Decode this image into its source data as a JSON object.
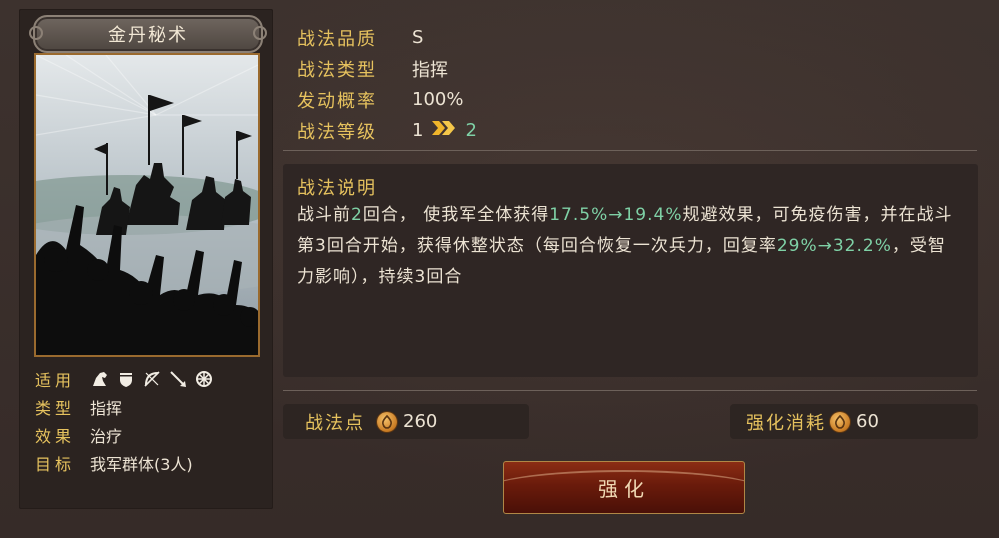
{
  "skill": {
    "name": "金丹秘术",
    "properties": [
      {
        "label": "适用",
        "value": "",
        "icons": [
          "cavalry-icon",
          "shield-icon",
          "bow-icon",
          "spear-icon",
          "wheel-icon"
        ]
      },
      {
        "label": "类型",
        "value": "指挥"
      },
      {
        "label": "效果",
        "value": "治疗"
      },
      {
        "label": "目标",
        "value": "我军群体(3人)"
      }
    ]
  },
  "stats": {
    "quality_label": "战法品质",
    "quality_value": "S",
    "type_label": "战法类型",
    "type_value": "指挥",
    "rate_label": "发动概率",
    "rate_value": "100%",
    "level_label": "战法等级",
    "level_current": "1",
    "level_next": "2",
    "level_arrow_icon": "double-chevron-right-icon"
  },
  "description": {
    "title": "战法说明",
    "segments": [
      {
        "text": "战斗前",
        "hl": false
      },
      {
        "text": "2",
        "hl": true
      },
      {
        "text": "回合， 使我军全体获得",
        "hl": false
      },
      {
        "text": "17.5%→19.4%",
        "hl": true
      },
      {
        "text": "规避效果，可免疫伤害，并在战斗第",
        "hl": false
      },
      {
        "text": "3",
        "hl": false
      },
      {
        "text": "回合开始，获得休整状态（每回合恢复一次兵力，回复率",
        "hl": false
      },
      {
        "text": "29%→32.2%",
        "hl": true
      },
      {
        "text": "，受智力影响），持续",
        "hl": false
      },
      {
        "text": "3",
        "hl": false
      },
      {
        "text": "回合",
        "hl": false
      }
    ]
  },
  "points": {
    "label": "战法点",
    "value": "260",
    "icon": "copper-coin-icon"
  },
  "cost": {
    "label": "强化消耗",
    "value": "60",
    "icon": "copper-coin-icon"
  },
  "upgrade_button": {
    "label": "强化"
  },
  "colors": {
    "gold_label": "#e6c25e",
    "highlight_green": "#7fd1a6",
    "button_red": "#6a1b0b"
  }
}
